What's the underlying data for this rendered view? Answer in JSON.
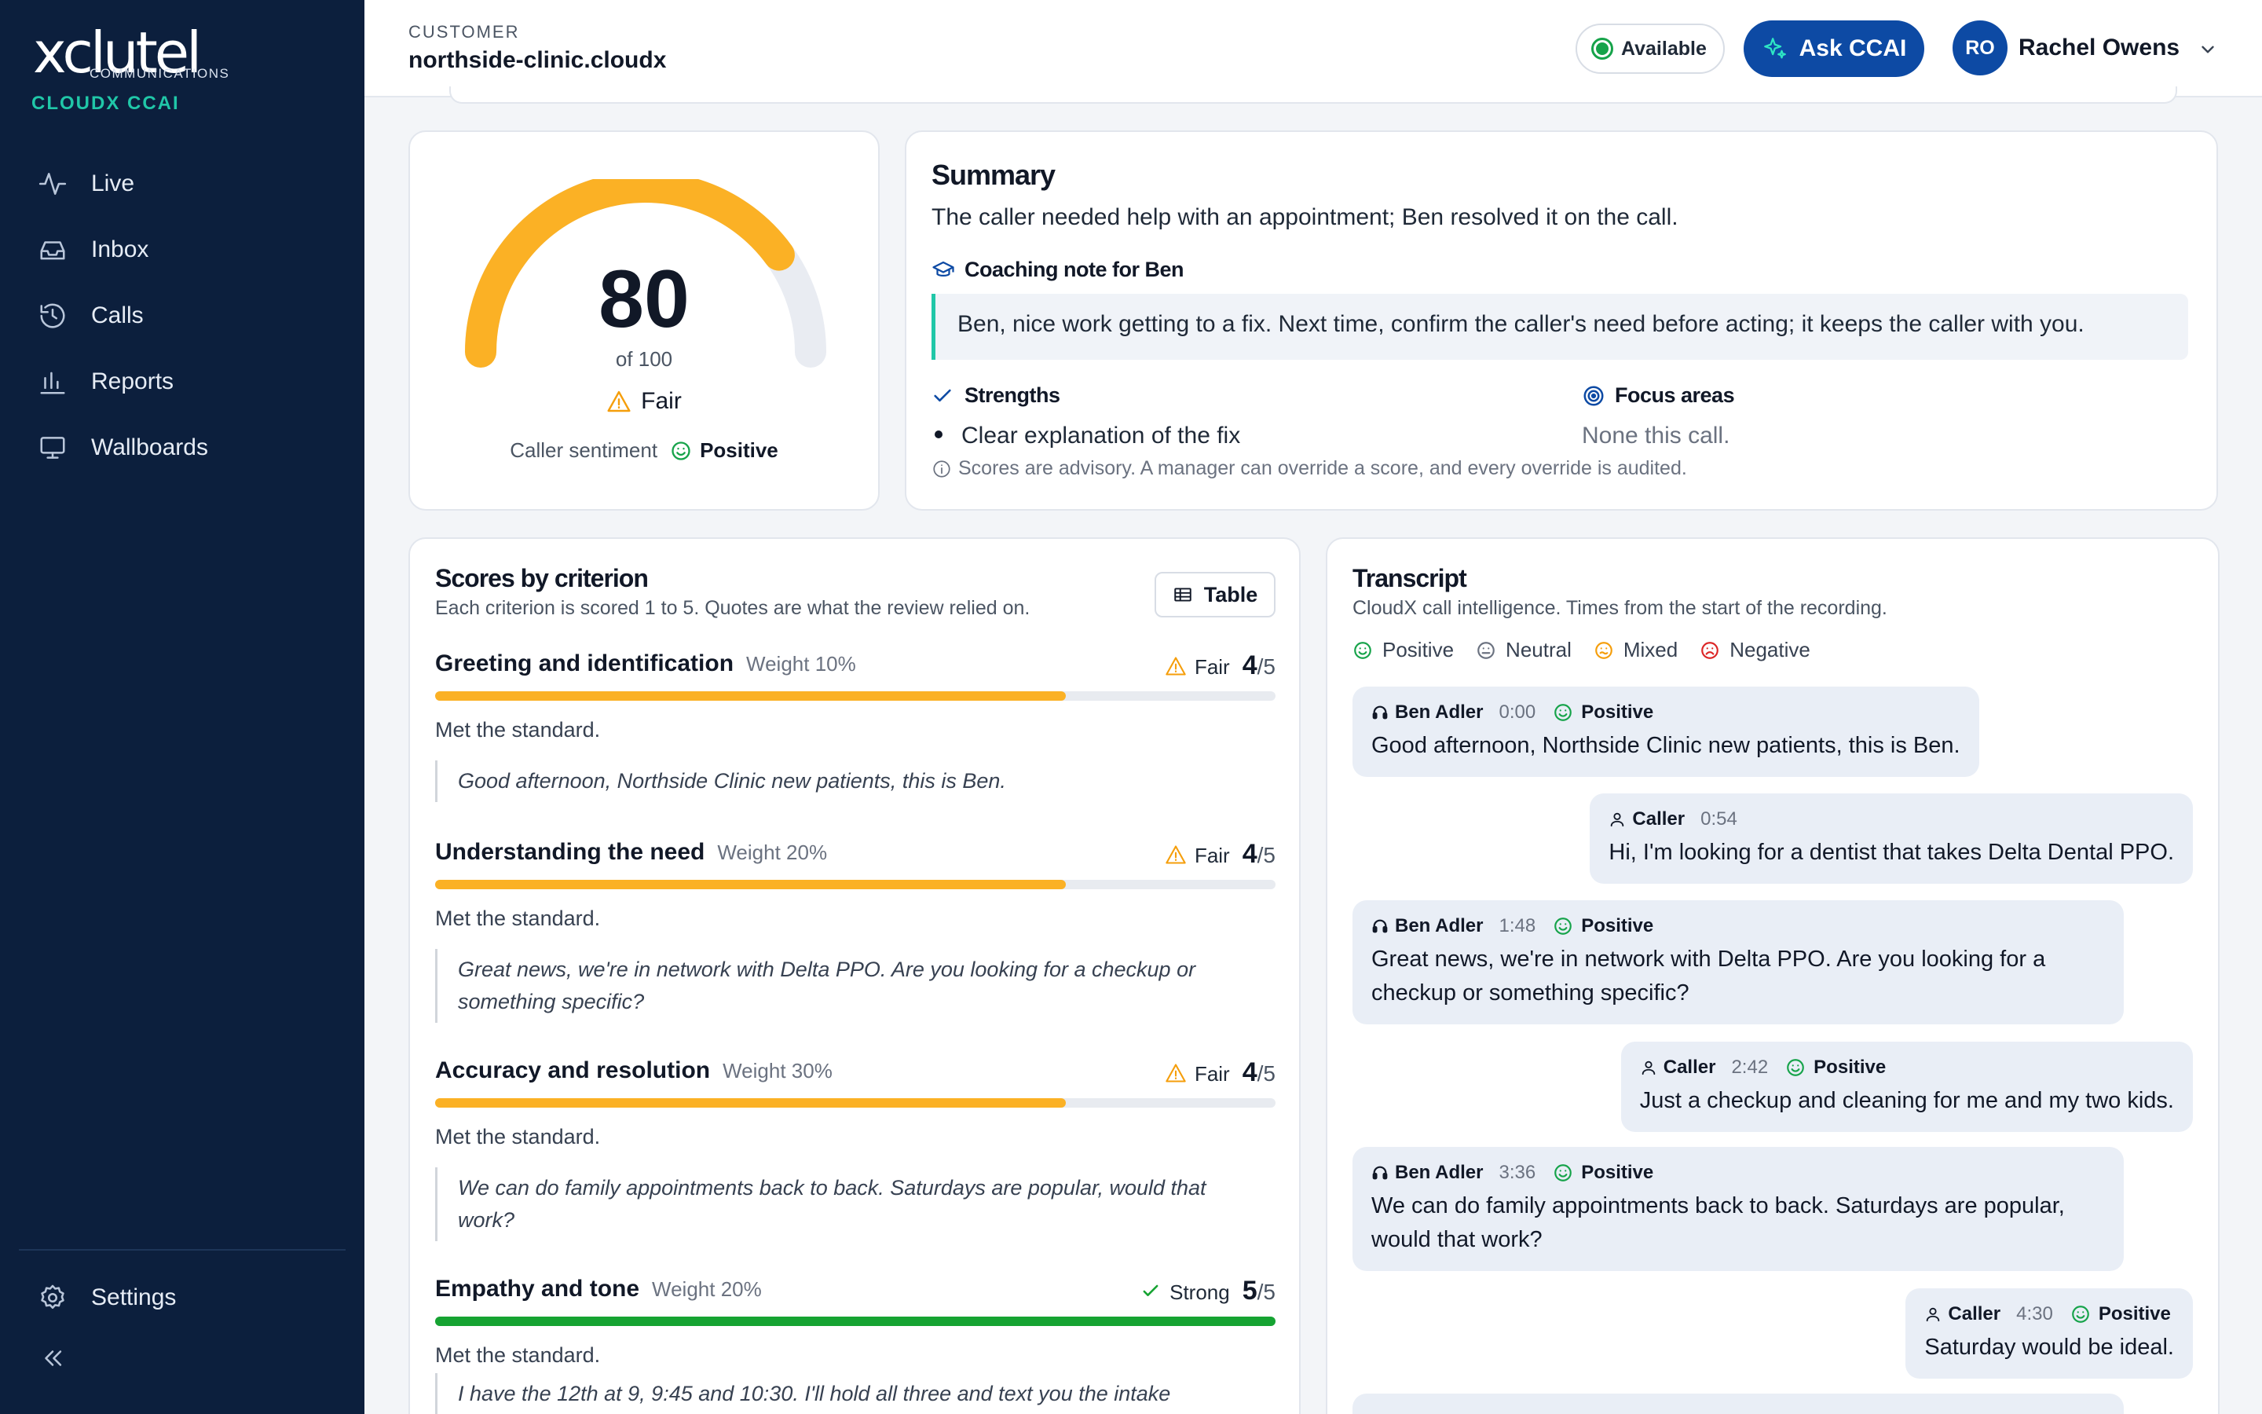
{
  "brand": {
    "logo_text": "xclutel",
    "logo_sub": "COMMUNICATIONS",
    "product": "CLOUDX CCAI"
  },
  "nav": [
    {
      "label": "Live",
      "icon": "pulse-icon"
    },
    {
      "label": "Inbox",
      "icon": "inbox-icon"
    },
    {
      "label": "Calls",
      "icon": "history-icon"
    },
    {
      "label": "Reports",
      "icon": "bar-chart-icon"
    },
    {
      "label": "Wallboards",
      "icon": "monitor-icon"
    }
  ],
  "settings_label": "Settings",
  "header": {
    "customer_label": "CUSTOMER",
    "customer_name": "northside-clinic.cloudx",
    "status": "Available",
    "ask_label": "Ask CCAI",
    "user_initials": "RO",
    "user_name": "Rachel Owens"
  },
  "score": {
    "value": 80,
    "max": 100,
    "of_label": "of 100",
    "rating": "Fair",
    "sentiment_label": "Caller sentiment",
    "sentiment_value": "Positive"
  },
  "summary": {
    "title": "Summary",
    "text": "The caller needed help with an appointment; Ben resolved it on the call.",
    "coaching_title": "Coaching note for Ben",
    "coaching_text": "Ben, nice work getting to a fix. Next time, confirm the caller's need before acting; it keeps the caller with you.",
    "strengths_title": "Strengths",
    "strengths": [
      "Clear explanation of the fix"
    ],
    "focus_title": "Focus areas",
    "focus_text": "None this call.",
    "note": "Scores are advisory. A manager can override a score, and every override is audited."
  },
  "scores": {
    "title": "Scores by criterion",
    "subtitle": "Each criterion is scored 1 to 5. Quotes are what the review relied on.",
    "table_label": "Table",
    "criteria": [
      {
        "name": "Greeting and identification",
        "weight": "Weight 10%",
        "rating": "Fair",
        "score": "4",
        "out_of": "/5",
        "fill": 0.75,
        "color": "#fbb125",
        "met": "Met the standard.",
        "quote": "Good afternoon, Northside Clinic new patients, this is Ben."
      },
      {
        "name": "Understanding the need",
        "weight": "Weight 20%",
        "rating": "Fair",
        "score": "4",
        "out_of": "/5",
        "fill": 0.75,
        "color": "#fbb125",
        "met": "Met the standard.",
        "quote": "Great news, we're in network with Delta PPO. Are you looking for a checkup or something specific?"
      },
      {
        "name": "Accuracy and resolution",
        "weight": "Weight 30%",
        "rating": "Fair",
        "score": "4",
        "out_of": "/5",
        "fill": 0.75,
        "color": "#fbb125",
        "met": "Met the standard.",
        "quote": "We can do family appointments back to back. Saturdays are popular, would that work?"
      },
      {
        "name": "Empathy and tone",
        "weight": "Weight 20%",
        "rating": "Strong",
        "score": "5",
        "out_of": "/5",
        "fill": 1.0,
        "color": "#16a332",
        "met": "Met the standard.",
        "quote": "I have the 12th at 9, 9:45 and 10:30. I'll hold all three and text you the intake"
      }
    ]
  },
  "transcript": {
    "title": "Transcript",
    "subtitle": "CloudX call intelligence. Times from the start of the recording.",
    "legend": [
      {
        "label": "Positive",
        "color": "#16a34a",
        "icon": "smile-icon"
      },
      {
        "label": "Neutral",
        "color": "#6b7280",
        "icon": "neutral-face-icon"
      },
      {
        "label": "Mixed",
        "color": "#f59e0b",
        "icon": "mixed-face-icon"
      },
      {
        "label": "Negative",
        "color": "#dc2626",
        "icon": "frown-icon"
      }
    ],
    "messages": [
      {
        "speaker": "Ben Adler",
        "role": "agent",
        "time": "0:00",
        "sentiment": "Positive",
        "text": "Good afternoon, Northside Clinic new patients, this is Ben."
      },
      {
        "speaker": "Caller",
        "role": "caller",
        "time": "0:54",
        "sentiment": "",
        "text": "Hi, I'm looking for a dentist that takes Delta Dental PPO."
      },
      {
        "speaker": "Ben Adler",
        "role": "agent",
        "time": "1:48",
        "sentiment": "Positive",
        "text": "Great news, we're in network with Delta PPO. Are you looking for a checkup or something specific?"
      },
      {
        "speaker": "Caller",
        "role": "caller",
        "time": "2:42",
        "sentiment": "Positive",
        "text": "Just a checkup and cleaning for me and my two kids."
      },
      {
        "speaker": "Ben Adler",
        "role": "agent",
        "time": "3:36",
        "sentiment": "Positive",
        "text": "We can do family appointments back to back. Saturdays are popular, would that work?"
      },
      {
        "speaker": "Caller",
        "role": "caller",
        "time": "4:30",
        "sentiment": "Positive",
        "text": "Saturday would be ideal."
      }
    ]
  }
}
